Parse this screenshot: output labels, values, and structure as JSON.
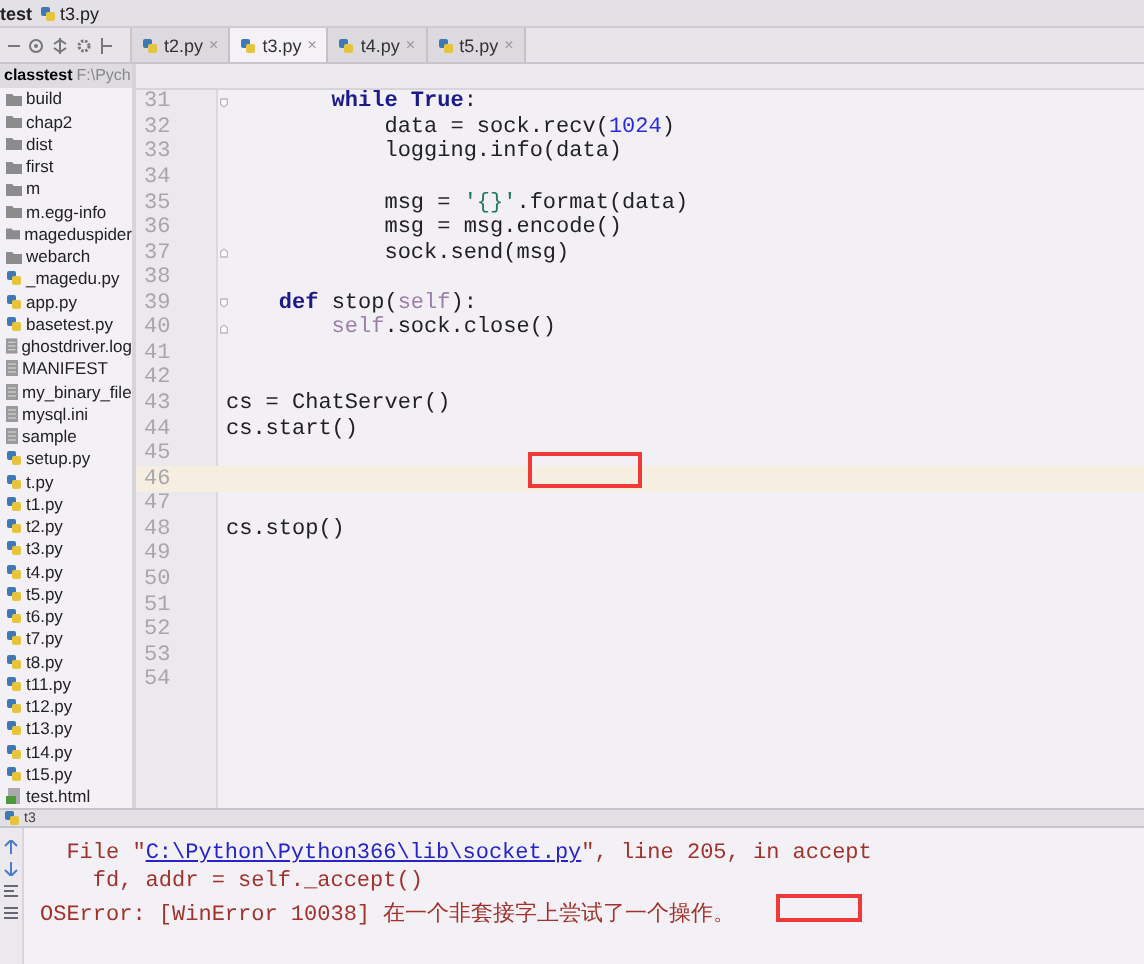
{
  "breadcrumb": [
    {
      "label": "test",
      "kind": "project"
    },
    {
      "label": "t3.py",
      "kind": "python"
    }
  ],
  "tabs": [
    {
      "label": "t2.py",
      "close": "×",
      "selected": false
    },
    {
      "label": "t3.py",
      "close": "×",
      "selected": true
    },
    {
      "label": "t4.py",
      "close": "×",
      "selected": false
    },
    {
      "label": "t5.py",
      "close": "×",
      "selected": false
    }
  ],
  "project": {
    "name": "classtest",
    "path": "F:\\Pych",
    "files": [
      {
        "name": "build",
        "kind": "folder"
      },
      {
        "name": "chap2",
        "kind": "folder"
      },
      {
        "name": "dist",
        "kind": "folder"
      },
      {
        "name": "first",
        "kind": "folder"
      },
      {
        "name": "m",
        "kind": "folder"
      },
      {
        "name": "m.egg-info",
        "kind": "folder"
      },
      {
        "name": "mageduspider",
        "kind": "folder"
      },
      {
        "name": "webarch",
        "kind": "folder"
      },
      {
        "name": "_magedu.py",
        "kind": "python"
      },
      {
        "name": "app.py",
        "kind": "python"
      },
      {
        "name": "basetest.py",
        "kind": "python"
      },
      {
        "name": "ghostdriver.log",
        "kind": "file"
      },
      {
        "name": "MANIFEST",
        "kind": "file"
      },
      {
        "name": "my_binary_file",
        "kind": "file"
      },
      {
        "name": "mysql.ini",
        "kind": "file"
      },
      {
        "name": "sample",
        "kind": "file"
      },
      {
        "name": "setup.py",
        "kind": "python"
      },
      {
        "name": "t.py",
        "kind": "python"
      },
      {
        "name": "t1.py",
        "kind": "python"
      },
      {
        "name": "t2.py",
        "kind": "python"
      },
      {
        "name": "t3.py",
        "kind": "python"
      },
      {
        "name": "t4.py",
        "kind": "python"
      },
      {
        "name": "t5.py",
        "kind": "python"
      },
      {
        "name": "t6.py",
        "kind": "python"
      },
      {
        "name": "t7.py",
        "kind": "python"
      },
      {
        "name": "t8.py",
        "kind": "python"
      },
      {
        "name": "t11.py",
        "kind": "python"
      },
      {
        "name": "t12.py",
        "kind": "python"
      },
      {
        "name": "t13.py",
        "kind": "python"
      },
      {
        "name": "t14.py",
        "kind": "python"
      },
      {
        "name": "t15.py",
        "kind": "python"
      },
      {
        "name": "test.html",
        "kind": "html"
      }
    ]
  },
  "editor": {
    "lines": [
      {
        "number": "31",
        "fold_start": true,
        "fold_end": false,
        "current": false,
        "segments": [
          {
            "kind": "keyword",
            "text": "        while True"
          },
          {
            "kind": "plain",
            "text": ":"
          }
        ]
      },
      {
        "number": "32",
        "fold_start": false,
        "fold_end": false,
        "current": false,
        "segments": [
          {
            "kind": "plain",
            "text": "            data = sock.recv("
          },
          {
            "kind": "number",
            "text": "1024"
          },
          {
            "kind": "plain",
            "text": ")"
          }
        ]
      },
      {
        "number": "33",
        "fold_start": false,
        "fold_end": false,
        "current": false,
        "segments": [
          {
            "kind": "plain",
            "text": "            logging.info(data)"
          }
        ]
      },
      {
        "number": "34",
        "fold_start": false,
        "fold_end": false,
        "current": false
      },
      {
        "number": "35",
        "fold_start": false,
        "fold_end": false,
        "current": false,
        "segments": [
          {
            "kind": "plain",
            "text": "            msg = "
          },
          {
            "kind": "string",
            "text": "'{}'"
          },
          {
            "kind": "plain",
            "text": ".format(data)"
          }
        ]
      },
      {
        "number": "36",
        "fold_start": false,
        "fold_end": false,
        "current": false,
        "segments": [
          {
            "kind": "plain",
            "text": "            msg = msg.encode()"
          }
        ]
      },
      {
        "number": "37",
        "fold_start": false,
        "fold_end": true,
        "current": false,
        "segments": [
          {
            "kind": "plain",
            "text": "            sock.send(msg)"
          }
        ]
      },
      {
        "number": "38",
        "fold_start": false,
        "fold_end": false,
        "current": false
      },
      {
        "number": "39",
        "fold_start": true,
        "fold_end": false,
        "current": false,
        "segments": [
          {
            "kind": "keyword",
            "text": "    def"
          },
          {
            "kind": "plain",
            "text": " stop("
          },
          {
            "kind": "self",
            "text": "self"
          },
          {
            "kind": "plain",
            "text": "):"
          }
        ]
      },
      {
        "number": "40",
        "fold_start": false,
        "fold_end": true,
        "current": false,
        "segments": [
          {
            "kind": "self",
            "text": "        self"
          },
          {
            "kind": "plain",
            "text": ".sock.close()"
          }
        ]
      },
      {
        "number": "41",
        "fold_start": false,
        "fold_end": false,
        "current": false
      },
      {
        "number": "42",
        "fold_start": false,
        "fold_end": false,
        "current": false
      },
      {
        "number": "43",
        "fold_start": false,
        "fold_end": false,
        "current": false,
        "segments": [
          {
            "kind": "plain",
            "text": "cs = ChatServer()"
          }
        ]
      },
      {
        "number": "44",
        "fold_start": false,
        "fold_end": false,
        "current": false,
        "segments": [
          {
            "kind": "plain",
            "text": "cs.start()"
          }
        ]
      },
      {
        "number": "45",
        "fold_start": false,
        "fold_end": false,
        "current": false
      },
      {
        "number": "46",
        "fold_start": false,
        "fold_end": false,
        "current": true
      },
      {
        "number": "47",
        "fold_start": false,
        "fold_end": false,
        "current": false
      },
      {
        "number": "48",
        "fold_start": false,
        "fold_end": false,
        "current": false,
        "segments": [
          {
            "kind": "plain",
            "text": "cs.stop()"
          }
        ]
      },
      {
        "number": "49",
        "fold_start": false,
        "fold_end": false,
        "current": false
      },
      {
        "number": "50",
        "fold_start": false,
        "fold_end": false,
        "current": false
      },
      {
        "number": "51",
        "fold_start": false,
        "fold_end": false,
        "current": false
      },
      {
        "number": "52",
        "fold_start": false,
        "fold_end": false,
        "current": false
      },
      {
        "number": "53",
        "fold_start": false,
        "fold_end": false,
        "current": false
      },
      {
        "number": "54",
        "fold_start": false,
        "fold_end": false,
        "current": false
      }
    ]
  },
  "run_panel": {
    "tab": "t3",
    "lines": [
      {
        "segments": [
          {
            "kind": "plain",
            "text": "  File \""
          },
          {
            "kind": "link",
            "text": "C:\\Python\\Python366\\lib\\socket.py"
          },
          {
            "kind": "plain",
            "text": "\", line 205, in accept"
          }
        ]
      },
      {
        "segments": [
          {
            "kind": "plain",
            "text": "    fd, addr = self._accept()"
          }
        ]
      },
      {
        "segments": [
          {
            "kind": "plain",
            "text": "OSError: [WinError 10038] 在一个非套接字上尝试了一个操作。"
          }
        ]
      }
    ]
  }
}
